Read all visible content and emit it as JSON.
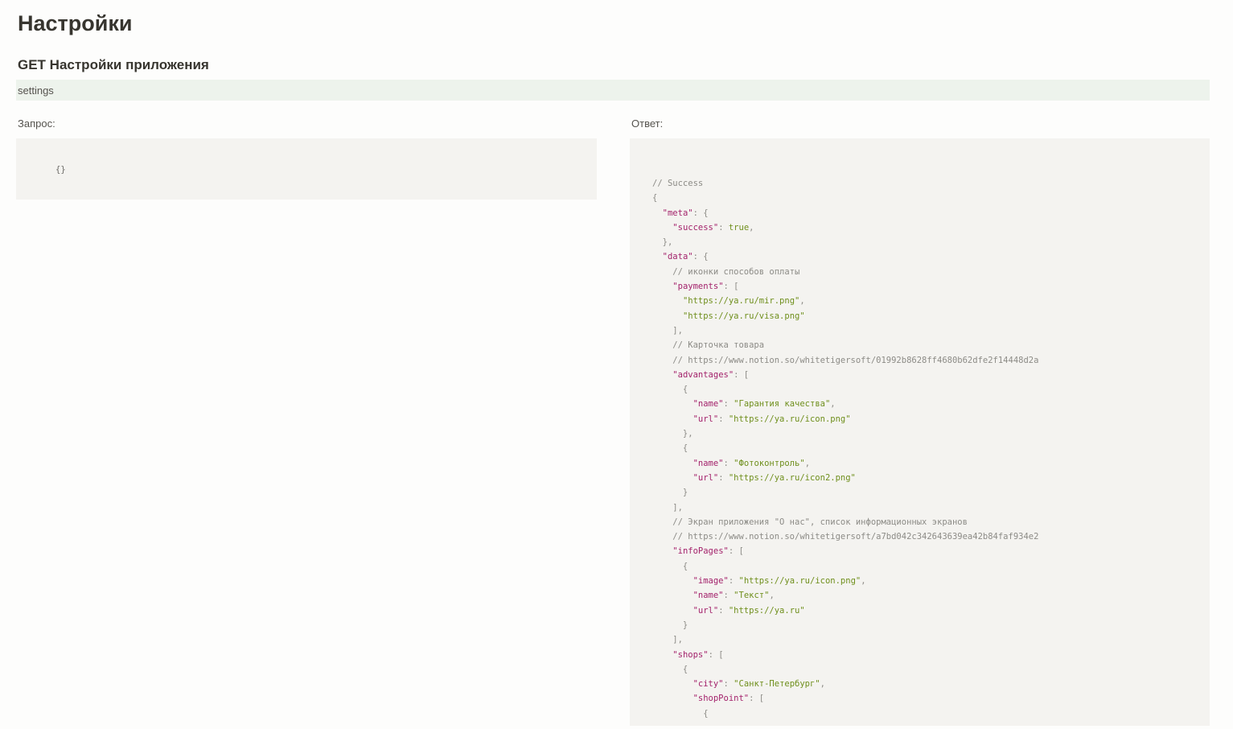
{
  "page": {
    "title": "Настройки",
    "section_title": "GET Настройки приложения",
    "endpoint": "settings",
    "request_label": "Запрос:",
    "response_label": "Ответ:"
  },
  "request": {
    "body": "{}"
  },
  "response": {
    "lines": [
      [
        [
          "// Success",
          "comment"
        ]
      ],
      [
        [
          "{",
          "punct"
        ]
      ],
      [
        [
          "  ",
          "punct"
        ],
        [
          "\"meta\"",
          "key"
        ],
        [
          ": {",
          "punct"
        ]
      ],
      [
        [
          "    ",
          "punct"
        ],
        [
          "\"success\"",
          "key"
        ],
        [
          ": ",
          "punct"
        ],
        [
          "true",
          "bool"
        ],
        [
          ",",
          "punct"
        ]
      ],
      [
        [
          "  },",
          "punct"
        ]
      ],
      [
        [
          "  ",
          "punct"
        ],
        [
          "\"data\"",
          "key"
        ],
        [
          ": {",
          "punct"
        ]
      ],
      [
        [
          "    // иконки способов оплаты",
          "comment"
        ]
      ],
      [
        [
          "    ",
          "punct"
        ],
        [
          "\"payments\"",
          "key"
        ],
        [
          ": [",
          "punct"
        ]
      ],
      [
        [
          "      ",
          "punct"
        ],
        [
          "\"https://ya.ru/mir.png\"",
          "str"
        ],
        [
          ",",
          "punct"
        ]
      ],
      [
        [
          "      ",
          "punct"
        ],
        [
          "\"https://ya.ru/visa.png\"",
          "str"
        ]
      ],
      [
        [
          "    ],",
          "punct"
        ]
      ],
      [
        [
          "    // Карточка товара",
          "comment"
        ]
      ],
      [
        [
          "    // https://www.notion.so/whitetigersoft/01992b8628ff4680b62dfe2f14448d2a",
          "comment"
        ]
      ],
      [
        [
          "    ",
          "punct"
        ],
        [
          "\"advantages\"",
          "key"
        ],
        [
          ": [",
          "punct"
        ]
      ],
      [
        [
          "      {",
          "punct"
        ]
      ],
      [
        [
          "        ",
          "punct"
        ],
        [
          "\"name\"",
          "key"
        ],
        [
          ": ",
          "punct"
        ],
        [
          "\"Гарантия качества\"",
          "str"
        ],
        [
          ",",
          "punct"
        ]
      ],
      [
        [
          "        ",
          "punct"
        ],
        [
          "\"url\"",
          "key"
        ],
        [
          ": ",
          "punct"
        ],
        [
          "\"https://ya.ru/icon.png\"",
          "str"
        ]
      ],
      [
        [
          "      },",
          "punct"
        ]
      ],
      [
        [
          "      {",
          "punct"
        ]
      ],
      [
        [
          "        ",
          "punct"
        ],
        [
          "\"name\"",
          "key"
        ],
        [
          ": ",
          "punct"
        ],
        [
          "\"Фотоконтроль\"",
          "str"
        ],
        [
          ",",
          "punct"
        ]
      ],
      [
        [
          "        ",
          "punct"
        ],
        [
          "\"url\"",
          "key"
        ],
        [
          ": ",
          "punct"
        ],
        [
          "\"https://ya.ru/icon2.png\"",
          "str"
        ]
      ],
      [
        [
          "      }",
          "punct"
        ]
      ],
      [
        [
          "    ],",
          "punct"
        ]
      ],
      [
        [
          "    // Экран приложения \"О нас\", список информационных экранов",
          "comment"
        ]
      ],
      [
        [
          "    // https://www.notion.so/whitetigersoft/a7bd042c342643639ea42b84faf934e2",
          "comment"
        ]
      ],
      [
        [
          "    ",
          "punct"
        ],
        [
          "\"infoPages\"",
          "key"
        ],
        [
          ": [",
          "punct"
        ]
      ],
      [
        [
          "      {",
          "punct"
        ]
      ],
      [
        [
          "        ",
          "punct"
        ],
        [
          "\"image\"",
          "key"
        ],
        [
          ": ",
          "punct"
        ],
        [
          "\"https://ya.ru/icon.png\"",
          "str"
        ],
        [
          ",",
          "punct"
        ]
      ],
      [
        [
          "        ",
          "punct"
        ],
        [
          "\"name\"",
          "key"
        ],
        [
          ": ",
          "punct"
        ],
        [
          "\"Текст\"",
          "str"
        ],
        [
          ",",
          "punct"
        ]
      ],
      [
        [
          "        ",
          "punct"
        ],
        [
          "\"url\"",
          "key"
        ],
        [
          ": ",
          "punct"
        ],
        [
          "\"https://ya.ru\"",
          "str"
        ]
      ],
      [
        [
          "      }",
          "punct"
        ]
      ],
      [
        [
          "    ],",
          "punct"
        ]
      ],
      [
        [
          "    ",
          "punct"
        ],
        [
          "\"shops\"",
          "key"
        ],
        [
          ": [",
          "punct"
        ]
      ],
      [
        [
          "      {",
          "punct"
        ]
      ],
      [
        [
          "        ",
          "punct"
        ],
        [
          "\"city\"",
          "key"
        ],
        [
          ": ",
          "punct"
        ],
        [
          "\"Санкт-Петербург\"",
          "str"
        ],
        [
          ",",
          "punct"
        ]
      ],
      [
        [
          "        ",
          "punct"
        ],
        [
          "\"shopPoint\"",
          "key"
        ],
        [
          ": [",
          "punct"
        ]
      ],
      [
        [
          "          {",
          "punct"
        ]
      ]
    ]
  },
  "colors": {
    "endpoint_bg": "#edf3ec",
    "code_bg": "#f4f3f0",
    "json_key": "#a3226b",
    "json_string": "#6f8f1c",
    "json_comment": "#8c8b86"
  }
}
